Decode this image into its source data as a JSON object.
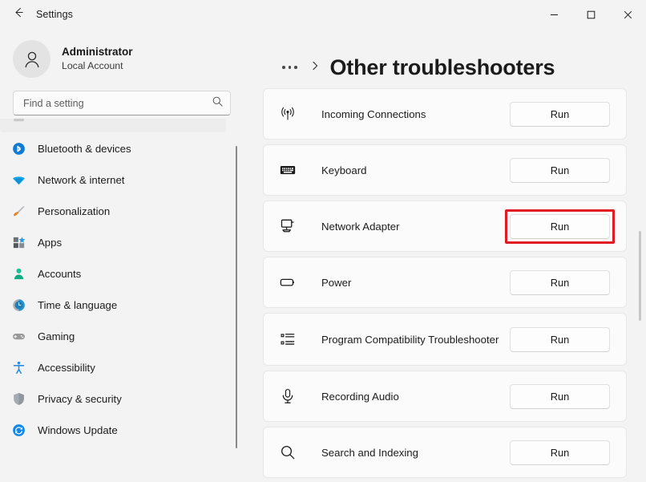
{
  "window": {
    "title": "Settings",
    "back_icon": "back-arrow-icon",
    "controls": {
      "minimize": "minimize-icon",
      "maximize": "maximize-icon",
      "close": "close-icon"
    }
  },
  "account": {
    "name": "Administrator",
    "subtitle": "Local Account",
    "avatar_icon": "person-avatar-icon"
  },
  "search": {
    "placeholder": "Find a setting",
    "value": "",
    "icon": "search-icon"
  },
  "sidebar": {
    "items": [
      {
        "label": "",
        "icon": "partial-item-icon",
        "partial": true,
        "selected": false
      },
      {
        "label": "Bluetooth & devices",
        "icon": "bluetooth-icon",
        "color": "#0f7bd6",
        "selected": false
      },
      {
        "label": "Network & internet",
        "icon": "wifi-icon",
        "color": "#12a5e8",
        "selected": false
      },
      {
        "label": "Personalization",
        "icon": "paintbrush-icon",
        "color": "#e8821e",
        "selected": false
      },
      {
        "label": "Apps",
        "icon": "apps-icon",
        "color": "#5a5a5a",
        "selected": false
      },
      {
        "label": "Accounts",
        "icon": "accounts-person-icon",
        "color": "#19c29a",
        "selected": false
      },
      {
        "label": "Time & language",
        "icon": "clock-icon",
        "color": "#2196d3",
        "selected": false
      },
      {
        "label": "Gaming",
        "icon": "gamepad-icon",
        "color": "#9a9a9a",
        "selected": false
      },
      {
        "label": "Accessibility",
        "icon": "accessibility-person-icon",
        "color": "#2d8fe0",
        "selected": false
      },
      {
        "label": "Privacy & security",
        "icon": "shield-icon",
        "color": "#a3acb3",
        "selected": false
      },
      {
        "label": "Windows Update",
        "icon": "update-refresh-icon",
        "color": "#0f87e8",
        "selected": false
      }
    ]
  },
  "main": {
    "breadcrumb_overflow": "…",
    "breadcrumb_separator": "›",
    "page_title": "Other troubleshooters",
    "run_label": "Run",
    "troubleshooters": [
      {
        "label": "Incoming Connections",
        "icon": "broadcast-signal-icon",
        "highlighted": false
      },
      {
        "label": "Keyboard",
        "icon": "keyboard-icon",
        "highlighted": false
      },
      {
        "label": "Network Adapter",
        "icon": "network-adapter-monitor-icon",
        "highlighted": true
      },
      {
        "label": "Power",
        "icon": "battery-icon",
        "highlighted": false
      },
      {
        "label": "Program Compatibility Troubleshooter",
        "icon": "list-bullets-icon",
        "highlighted": false
      },
      {
        "label": "Recording Audio",
        "icon": "microphone-icon",
        "highlighted": false
      },
      {
        "label": "Search and Indexing",
        "icon": "magnifier-icon",
        "highlighted": false
      }
    ]
  },
  "colors": {
    "highlight_red": "#e01b24",
    "window_bg": "#f3f3f3",
    "card_bg": "#fbfbfb",
    "text": "#1b1b1b"
  }
}
